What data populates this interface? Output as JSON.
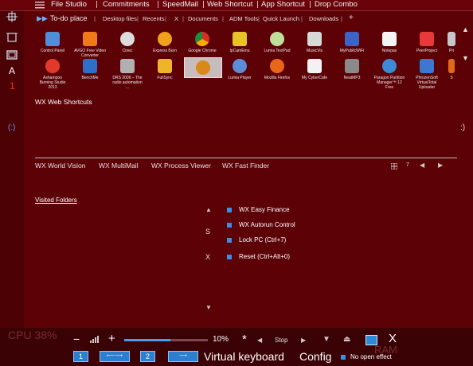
{
  "top_menu": [
    "File Studio",
    "Commitments",
    "SpeedMail",
    "Web Shortcut",
    "App Shortcut",
    "Drop Combo"
  ],
  "toolbar": {
    "todo": "To-do place",
    "items": [
      "Desktop files",
      "Recents",
      "X",
      "Documents",
      "ADM Tools",
      "Quick Launch",
      "Downloads",
      "+"
    ]
  },
  "apps_row1": [
    "Control Panel",
    "AVGO Free Video Converter",
    "Cinec",
    "Express Burn",
    "Google Chrome",
    "IpCamEmu",
    "Lumia TextPad",
    "MusicVis",
    "MyPublicWiFi",
    "Notepas",
    "PeerProject",
    "Pri"
  ],
  "apps_row2": [
    "Ashampoo Burning Studio 2013",
    "BenchMe",
    "DRS 2006 – The radio automation ...",
    "FullSync",
    "",
    "Lumia Player",
    "Mozilla Firefox",
    "My CyberCafe",
    "NeatMP3",
    "Paragon Partition Manager™ 12 Free",
    "PhrozenSoft VirtualTotal Uploader",
    "S"
  ],
  "sections": {
    "web_shortcuts": "WX Web Shortcuts",
    "visited_folders": "Visited Folders"
  },
  "wx_links": [
    "WX World Vision",
    "WX MultiMail",
    "WX Process Viewer",
    "WX Fast Finder"
  ],
  "pager": {
    "page": "7"
  },
  "left_letters": {
    "a": "A",
    "one": "1"
  },
  "side_arrows": {
    "left": "(:)",
    "right": ":)"
  },
  "shortcuts": [
    "WX Easy Finance",
    "WX Autorun Control",
    "Lock PC (Ctrl+7)",
    "Reset (Ctrl+Alt+0)"
  ],
  "shortcut_letters": {
    "s": "S",
    "x": "X"
  },
  "bottom": {
    "minus": "−",
    "plus": "+",
    "volume": "10%",
    "star": "*",
    "stop": "Stop",
    "close": "X",
    "btn1": "1",
    "btn2": "2",
    "virtual_keyboard": "Virtual keyboard",
    "config": "Config",
    "open_effect": "No open effect",
    "ghost_cpu": "CPU 38%",
    "ghost_ram": "RAM"
  },
  "volume_level": 0.55,
  "colors": {
    "background": "#5c0207",
    "accent": "#2c7fd0",
    "bottom_bar": "#3b0205"
  }
}
